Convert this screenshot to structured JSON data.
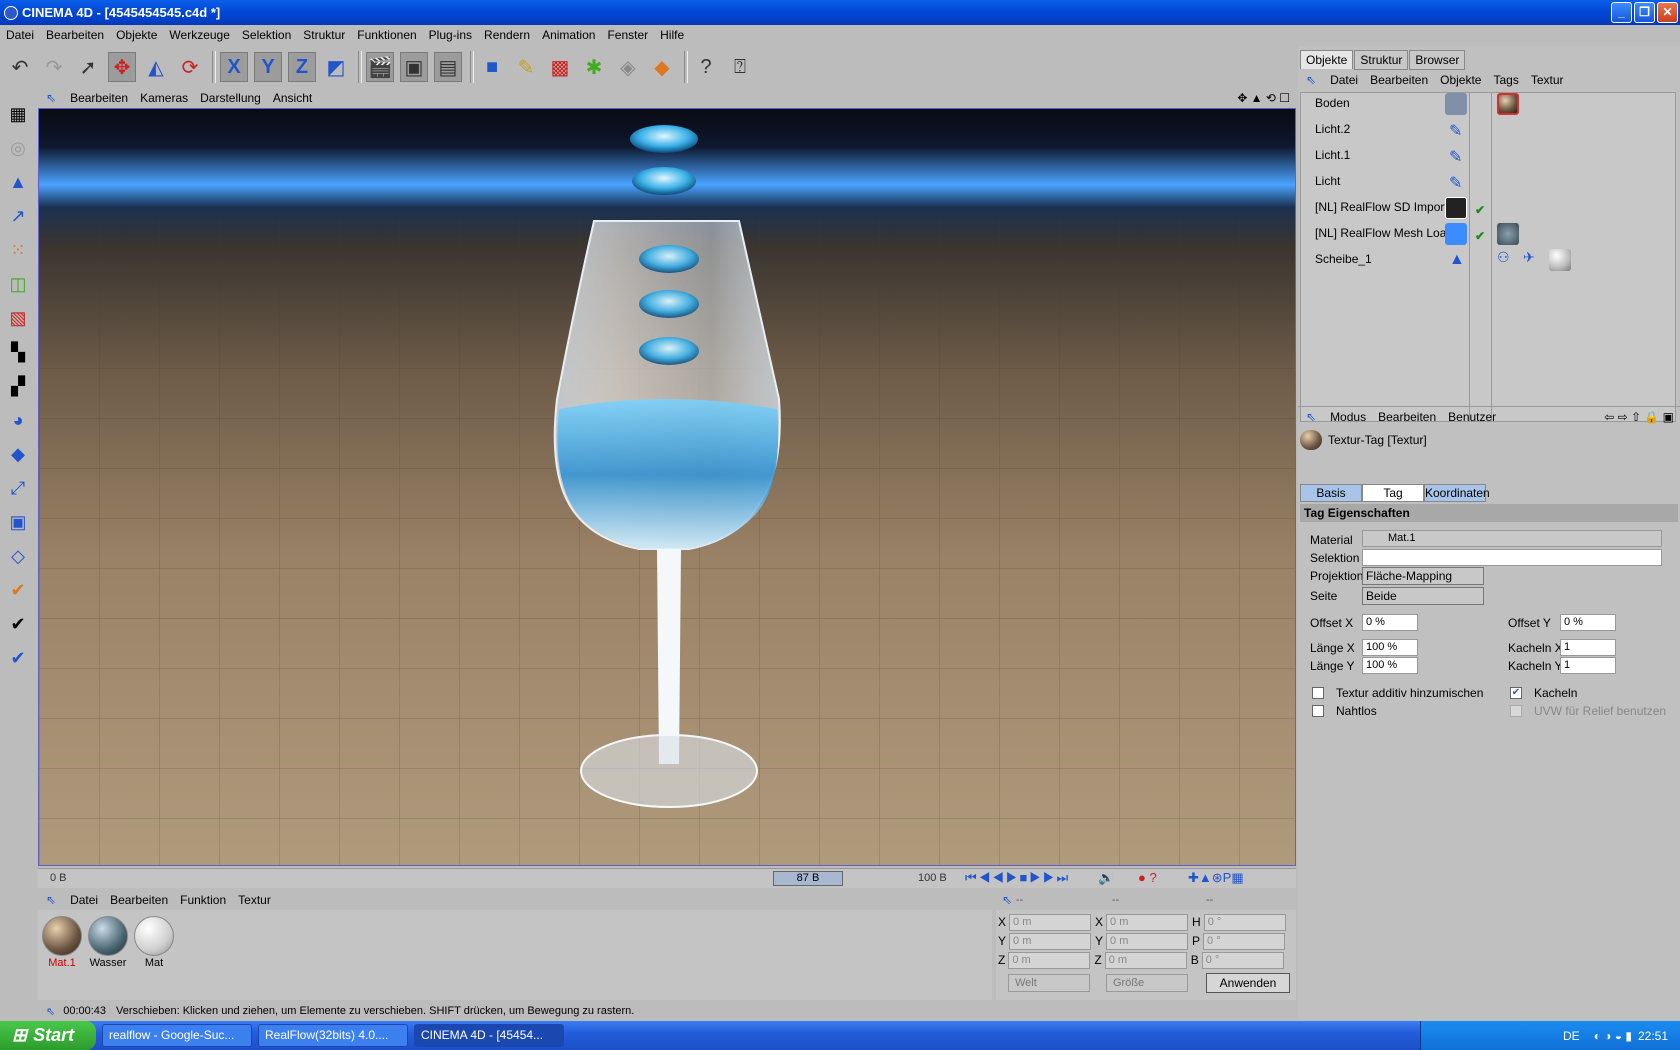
{
  "window": {
    "title": "CINEMA 4D - [4545454545.c4d *]"
  },
  "menu": [
    "Datei",
    "Bearbeiten",
    "Objekte",
    "Werkzeuge",
    "Selektion",
    "Struktur",
    "Funktionen",
    "Plug-ins",
    "Rendern",
    "Animation",
    "Fenster",
    "Hilfe"
  ],
  "viewport": {
    "menu": [
      "Bearbeiten",
      "Kameras",
      "Darstellung",
      "Ansicht"
    ]
  },
  "timeline": {
    "start": "0 B",
    "current": "87 B",
    "end": "100 B"
  },
  "materials": {
    "menu": [
      "Datei",
      "Bearbeiten",
      "Funktion",
      "Textur"
    ],
    "items": [
      {
        "name": "Mat.1",
        "color": "#6a5440"
      },
      {
        "name": "Wasser",
        "color": "#4a6472"
      },
      {
        "name": "Mat",
        "color": "#cfcfcf"
      }
    ]
  },
  "coords": {
    "headers": [
      "--",
      "--",
      "--"
    ],
    "rows": [
      {
        "a": "X",
        "av": "0 m",
        "b": "X",
        "bv": "0 m",
        "c": "H",
        "cv": "0 °"
      },
      {
        "a": "Y",
        "av": "0 m",
        "b": "Y",
        "bv": "0 m",
        "c": "P",
        "cv": "0 °"
      },
      {
        "a": "Z",
        "av": "0 m",
        "b": "Z",
        "bv": "0 m",
        "c": "B",
        "cv": "0 °"
      }
    ],
    "space": "Welt",
    "size": "Größe",
    "apply": "Anwenden"
  },
  "status": {
    "time": "00:00:43",
    "text": "Verschieben: Klicken und ziehen, um Elemente zu verschieben. SHIFT drücken, um Bewegung zu rastern."
  },
  "objectmanager": {
    "tabs": [
      "Objekte",
      "Struktur",
      "Browser"
    ],
    "menu": [
      "Datei",
      "Bearbeiten",
      "Objekte",
      "Tags",
      "Textur"
    ],
    "objects": [
      "Boden",
      "Licht.2",
      "Licht.1",
      "Licht",
      "[NL] RealFlow SD Import",
      "[NL] RealFlow Mesh Loader",
      "Scheibe_1"
    ]
  },
  "attributes": {
    "menu": [
      "Modus",
      "Bearbeiten",
      "Benutzer"
    ],
    "title": "Textur-Tag [Textur]",
    "tabs": [
      "Basis",
      "Tag",
      "Koordinaten"
    ],
    "section": "Tag Eigenschaften",
    "material_label": "Material",
    "material": "Mat.1",
    "selection_label": "Selektion",
    "projection_label": "Projektion",
    "projection": "Fläche-Mapping",
    "side_label": "Seite",
    "side": "Beide",
    "offsetx_label": "Offset X",
    "offsetx": "0 %",
    "offsety_label": "Offset Y",
    "offsety": "0 %",
    "lengthx_label": "Länge X",
    "lengthx": "100 %",
    "lengthy_label": "Länge Y",
    "lengthy": "100 %",
    "tilesx_label": "Kacheln X",
    "tilesx": "1",
    "tilesy_label": "Kacheln Y",
    "tilesy": "1",
    "additive_label": "Textur additiv hinzumischen",
    "tile_label": "Kacheln",
    "seamless_label": "Nahtlos",
    "uvw_label": "UVW für Relief benutzen"
  },
  "taskbar": {
    "start": "Start",
    "tasks": [
      "realflow - Google-Suc...",
      "RealFlow(32bits) 4.0....",
      "CINEMA 4D - [45454..."
    ],
    "lang": "DE",
    "clock": "22:51"
  },
  "colors": {
    "accent": "#0a5ee8",
    "viewport_border": "#6060c8",
    "sky_glow": "#4aa3ff"
  }
}
